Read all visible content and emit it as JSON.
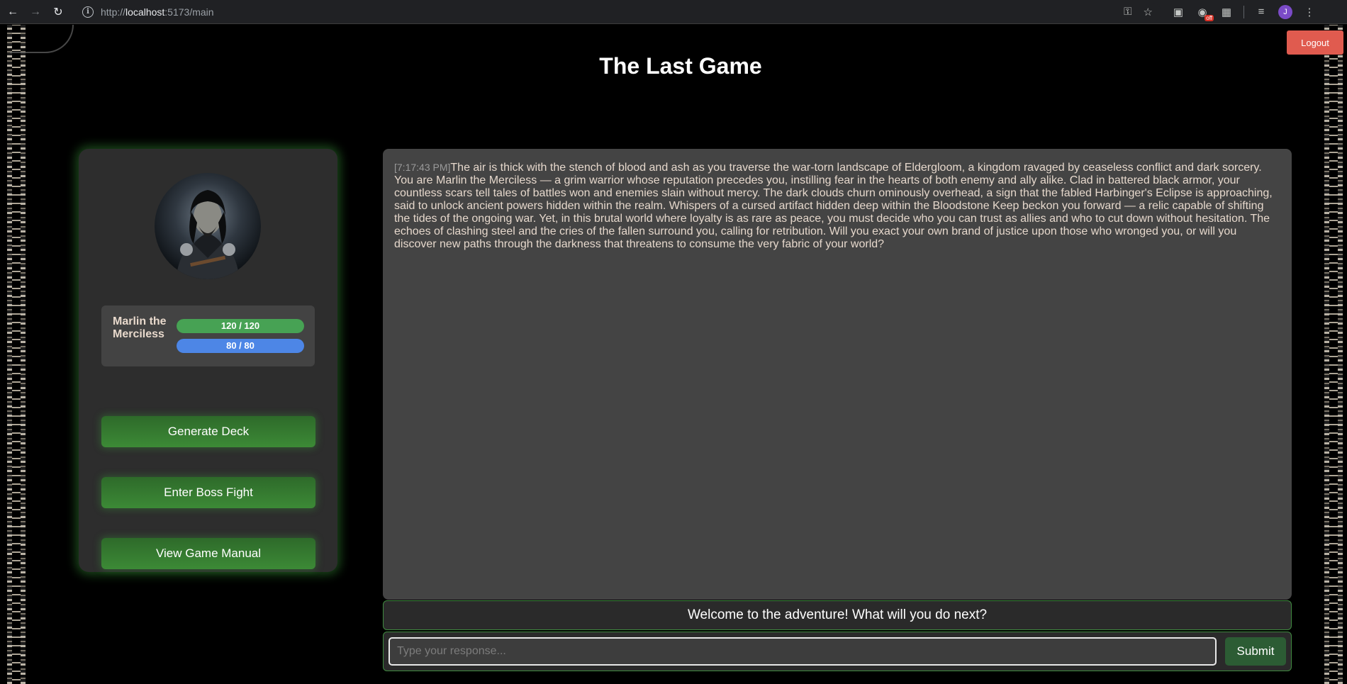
{
  "browser": {
    "url_prefix": "http://",
    "url_host": "localhost",
    "url_rest": ":5173/main",
    "back_icon": "arrow-left-icon",
    "forward_icon": "arrow-right-icon",
    "reload_icon": "reload-icon",
    "ext_badge": "off",
    "profile_initial": "J"
  },
  "header": {
    "title": "The Last Game",
    "logout_label": "Logout"
  },
  "character": {
    "name": "Marlin the Merciless",
    "hp_text": "120 / 120",
    "hp_fraction": 1.0,
    "mp_text": "80 / 80",
    "mp_fraction": 1.0,
    "hp_color": "#47a254",
    "mp_color": "#4d86e6"
  },
  "actions": {
    "generate_deck": "Generate Deck",
    "boss_fight": "Enter Boss Fight",
    "manual": "View Game Manual"
  },
  "story": {
    "timestamp": "[7:17:43 PM]",
    "text": "The air is thick with the stench of blood and ash as you traverse the war-torn landscape of Eldergloom, a kingdom ravaged by ceaseless conflict and dark sorcery. You are Marlin the Merciless — a grim warrior whose reputation precedes you, instilling fear in the hearts of both enemy and ally alike. Clad in battered black armor, your countless scars tell tales of battles won and enemies slain without mercy. The dark clouds churn ominously overhead, a sign that the fabled Harbinger's Eclipse is approaching, said to unlock ancient powers hidden within the realm. Whispers of a cursed artifact hidden deep within the Bloodstone Keep beckon you forward — a relic capable of shifting the tides of the ongoing war. Yet, in this brutal world where loyalty is as rare as peace, you must decide who you can trust as allies and who to cut down without hesitation. The echoes of clashing steel and the cries of the fallen surround you, calling for retribution. Will you exact your own brand of justice upon those who wronged you, or will you discover new paths through the darkness that threatens to consume the very fabric of your world?"
  },
  "prompt": {
    "message": "Welcome to the adventure! What will you do next?",
    "placeholder": "Type your response...",
    "submit_label": "Submit"
  }
}
